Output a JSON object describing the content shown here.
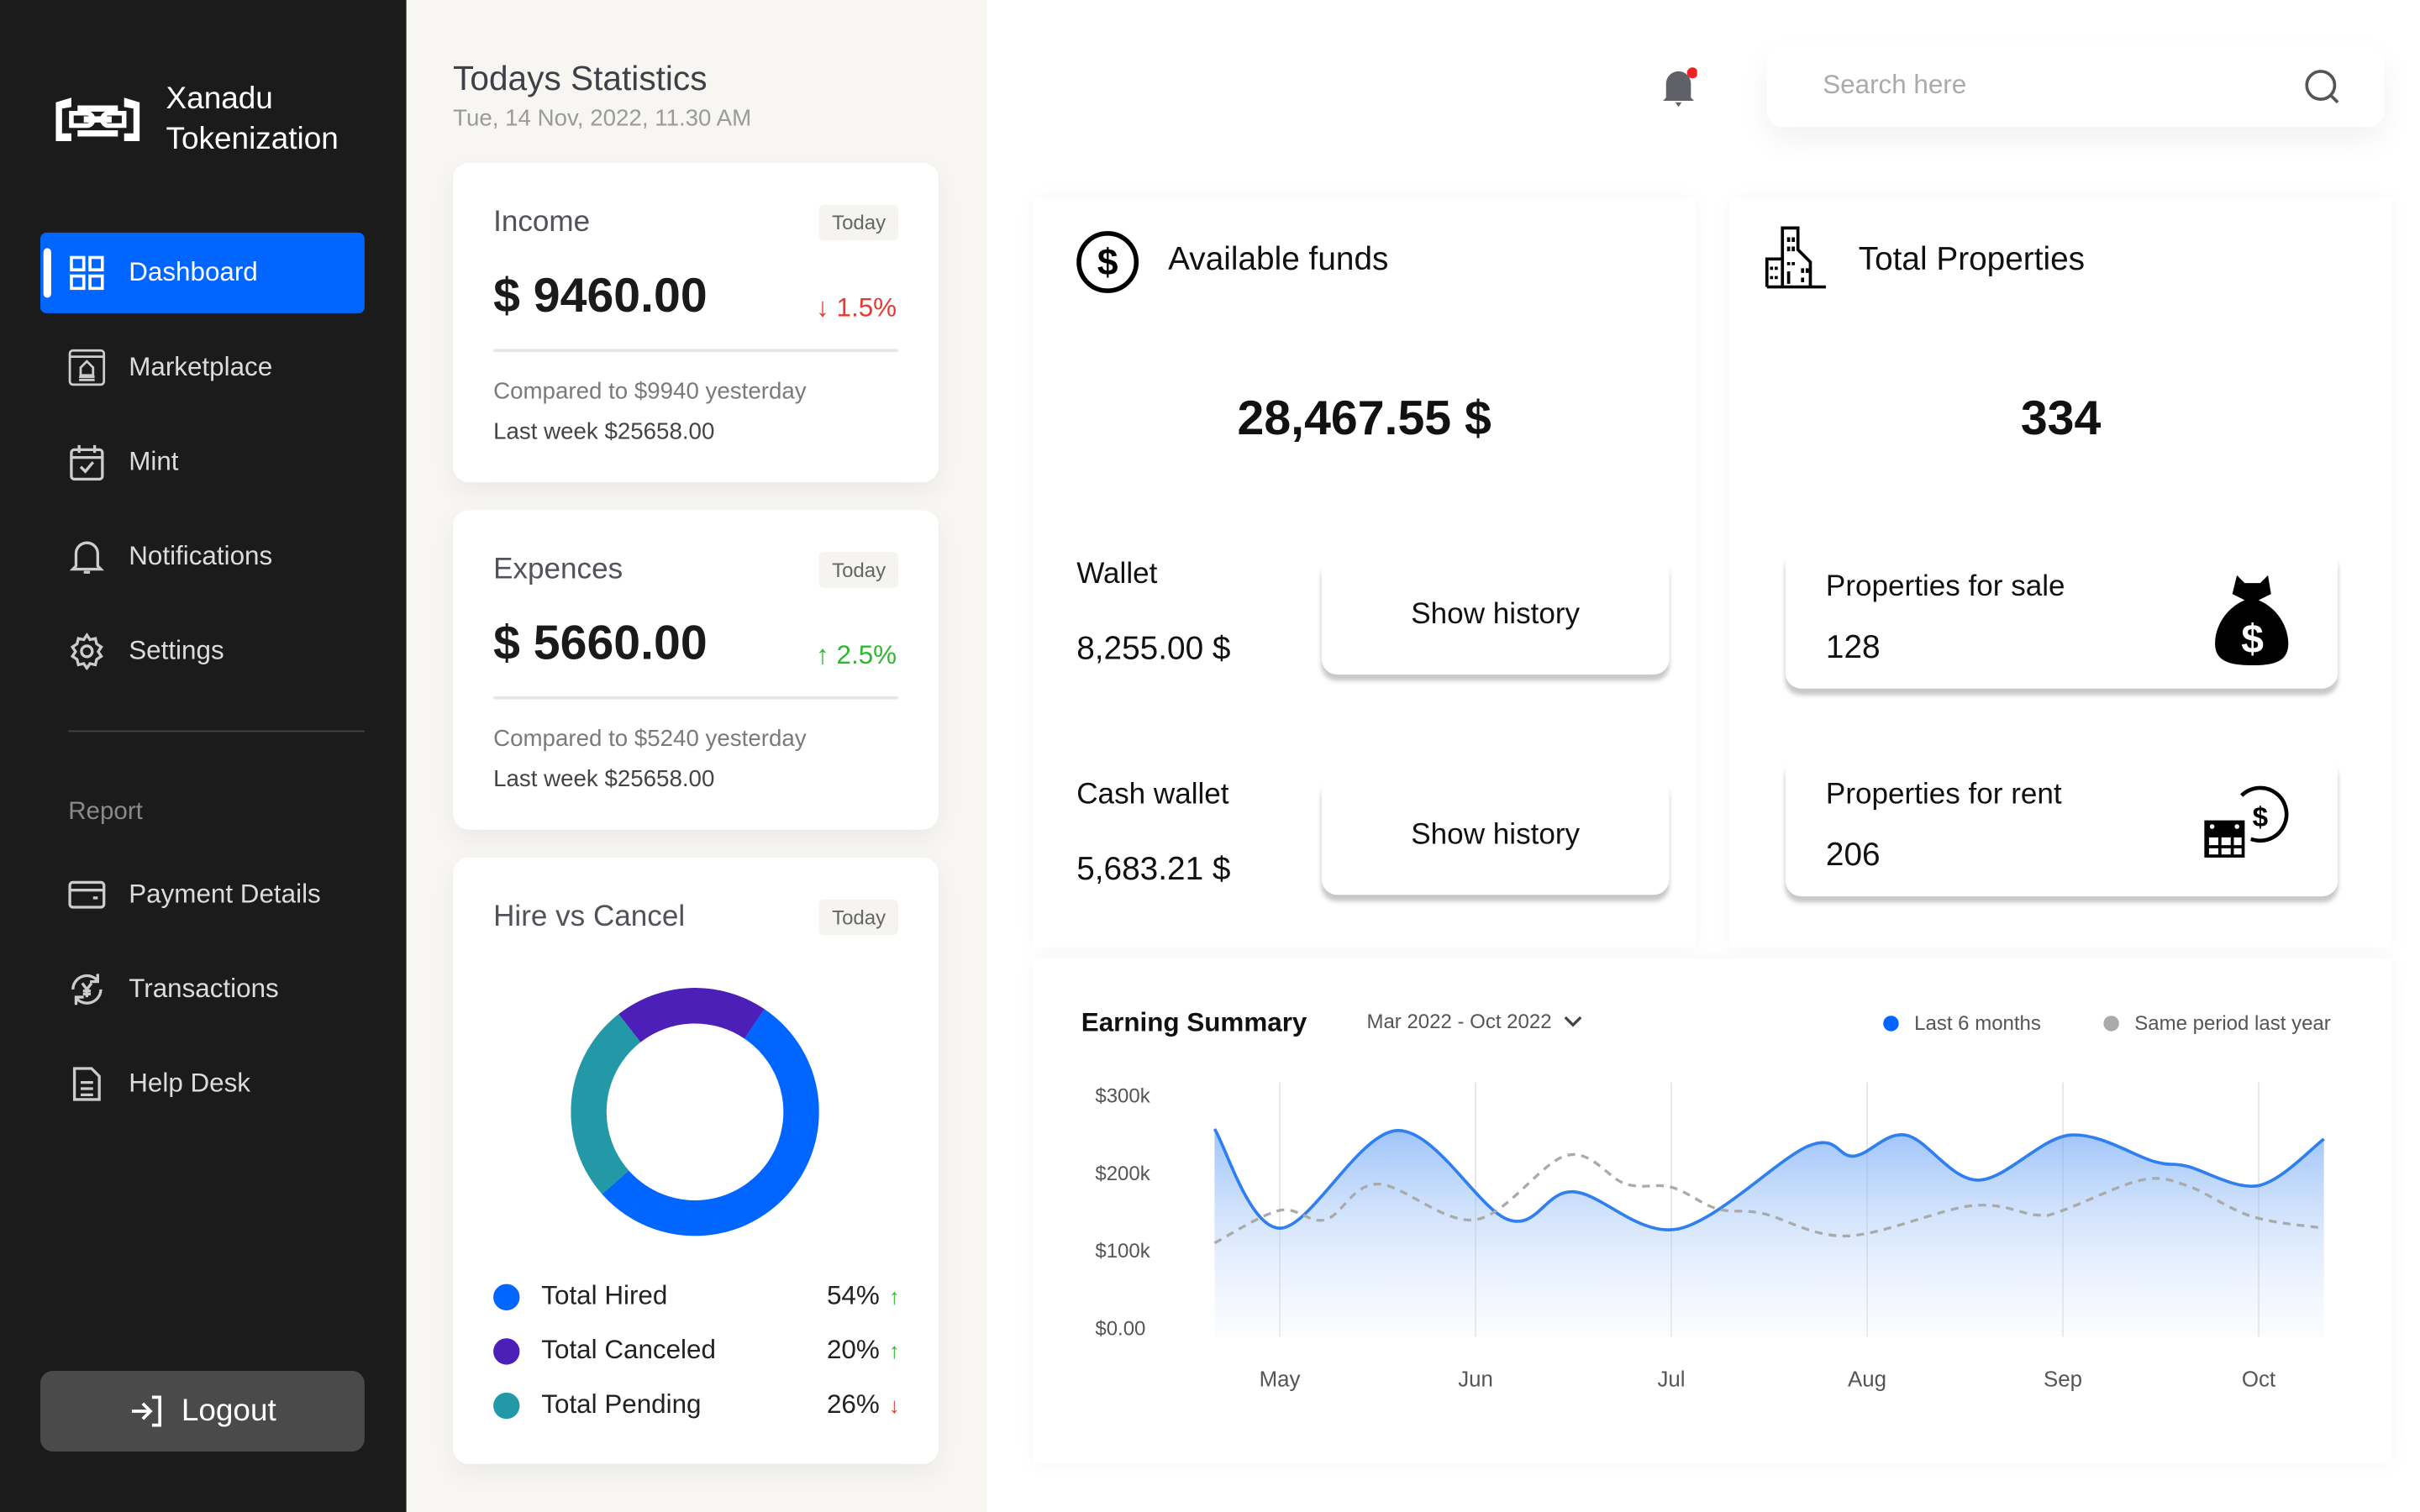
{
  "brand": {
    "line1": "Xanadu",
    "line2": "Tokenization"
  },
  "sidebar": {
    "items": [
      {
        "label": "Dashboard",
        "icon": "grid-icon",
        "active": true
      },
      {
        "label": "Marketplace",
        "icon": "storefront-icon"
      },
      {
        "label": "Mint",
        "icon": "calendar-check-icon"
      },
      {
        "label": "Notifications",
        "icon": "bell-icon"
      },
      {
        "label": "Settings",
        "icon": "gear-icon"
      }
    ],
    "section_label": "Report",
    "report_items": [
      {
        "label": "Payment Details",
        "icon": "card-icon"
      },
      {
        "label": "Transactions",
        "icon": "yen-exchange-icon"
      },
      {
        "label": "Help Desk",
        "icon": "document-icon"
      }
    ],
    "logout_label": "Logout"
  },
  "stats": {
    "title": "Todays Statistics",
    "date": "Tue, 14 Nov, 2022, 11.30 AM",
    "income": {
      "label": "Income",
      "badge": "Today",
      "amount": "$ 9460.00",
      "change": "1.5%",
      "direction": "down",
      "compared": "Compared to $9940 yesterday",
      "last_week": "Last week $25658.00"
    },
    "expenses": {
      "label": "Expences",
      "badge": "Today",
      "amount": "$ 5660.00",
      "change": "2.5%",
      "direction": "up",
      "compared": "Compared to $5240 yesterday",
      "last_week": "Last week $25658.00"
    },
    "hire": {
      "label": "Hire vs Cancel",
      "badge": "Today",
      "legend": [
        {
          "label": "Total Hired",
          "pct": "54%",
          "value": 54,
          "direction": "up",
          "color": "#0066ff"
        },
        {
          "label": "Total Canceled",
          "pct": "20%",
          "value": 20,
          "direction": "up",
          "color": "#4c1fb8"
        },
        {
          "label": "Total Pending",
          "pct": "26%",
          "value": 26,
          "direction": "down",
          "color": "#2399a8"
        }
      ]
    }
  },
  "header": {
    "search_placeholder": "Search here",
    "notification_dot": true
  },
  "funds": {
    "title": "Available funds",
    "total": "28,467.55 $",
    "wallet_label": "Wallet",
    "wallet_value": "8,255.00 $",
    "cash_label": "Cash wallet",
    "cash_value": "5,683.21 $",
    "history_label": "Show history"
  },
  "properties": {
    "title": "Total Properties",
    "total": "334",
    "sale_label": "Properties for sale",
    "sale_value": "128",
    "rent_label": "Properties for rent",
    "rent_value": "206"
  },
  "colors": {
    "accent": "#0066ff",
    "down": "#e53935",
    "up": "#2eb82e",
    "sidebar": "#1b1b1b"
  },
  "chart_data": {
    "type": "area",
    "title": "Earning Summary",
    "range_label": "Mar 2022 - Oct 2022",
    "categories": [
      "May",
      "Jun",
      "Jul",
      "Aug",
      "Sep",
      "Oct"
    ],
    "y_ticks": [
      "$300k",
      "$200k",
      "$100k",
      "$0.00"
    ],
    "ylim": [
      0,
      300000
    ],
    "grid": "vertical",
    "legend_position": "top-right",
    "series": [
      {
        "name": "Last 6 months",
        "color": "#2f7ff0",
        "style": "solid-area",
        "points": [
          [
            "2022-04-21",
            258000
          ],
          [
            "2022-05-01",
            130000
          ],
          [
            "2022-05-19",
            256000
          ],
          [
            "2022-06-06",
            141000
          ],
          [
            "2022-06-16",
            177000
          ],
          [
            "2022-07-02",
            129000
          ],
          [
            "2022-07-22",
            236000
          ],
          [
            "2022-07-29",
            223000
          ],
          [
            "2022-08-07",
            250000
          ],
          [
            "2022-08-18",
            192000
          ],
          [
            "2022-09-02",
            250000
          ],
          [
            "2022-09-15",
            216000
          ],
          [
            "2022-09-20",
            210000
          ],
          [
            "2022-10-01",
            185000
          ],
          [
            "2022-10-11",
            245000
          ]
        ]
      },
      {
        "name": "Same period last year",
        "color": "#aaaaaa",
        "style": "dashed",
        "points": [
          [
            "2022-04-21",
            111000
          ],
          [
            "2022-05-01",
            153000
          ],
          [
            "2022-05-08",
            141000
          ],
          [
            "2022-05-16",
            187000
          ],
          [
            "2022-06-01",
            141000
          ],
          [
            "2022-06-15",
            224000
          ],
          [
            "2022-06-24",
            187000
          ],
          [
            "2022-07-01",
            183000
          ],
          [
            "2022-07-08",
            155000
          ],
          [
            "2022-07-15",
            149000
          ],
          [
            "2022-07-28",
            120000
          ],
          [
            "2022-08-17",
            159000
          ],
          [
            "2022-08-27",
            147000
          ],
          [
            "2022-09-01",
            153000
          ],
          [
            "2022-09-13",
            192000
          ],
          [
            "2022-09-20",
            185000
          ],
          [
            "2022-09-30",
            145000
          ],
          [
            "2022-10-11",
            130000
          ]
        ]
      }
    ]
  }
}
